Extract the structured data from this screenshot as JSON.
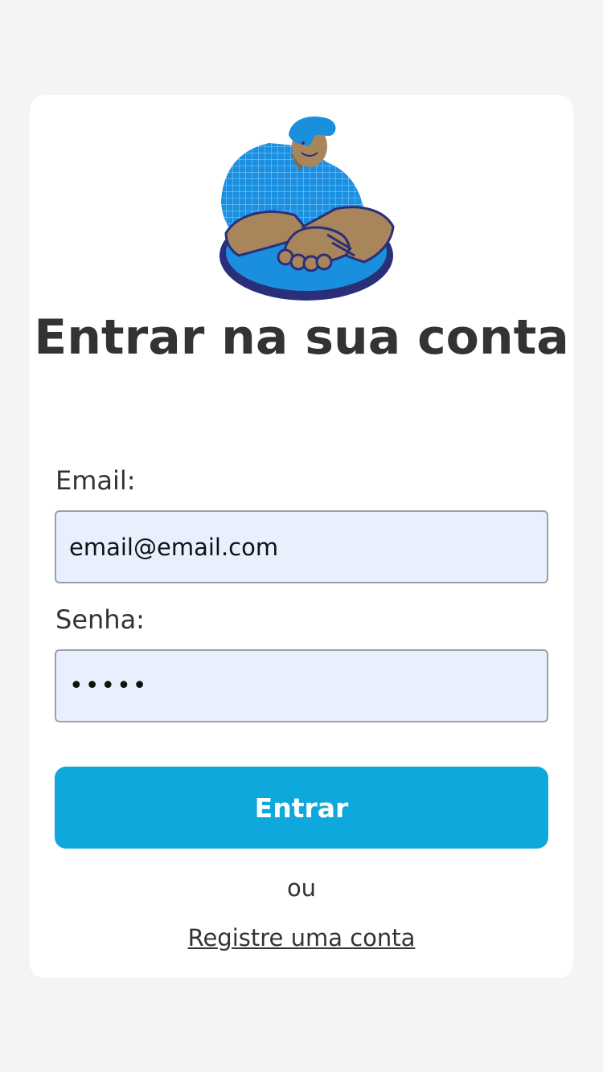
{
  "illustration": {
    "icon": "handshake-illustration",
    "description_colors": {
      "accent": "#0ea8dc",
      "dark": "#2a2f7a",
      "skin": "#a8855a"
    }
  },
  "login": {
    "title": "Entrar na sua conta",
    "email_label": "Email:",
    "email_value": "email@email.com",
    "password_label": "Senha:",
    "password_value": "12345",
    "submit_label": "Entrar",
    "or_text": "ou",
    "register_link": "Registre uma conta"
  },
  "colors": {
    "background": "#f4f4f4",
    "card": "#ffffff",
    "primary_button": "#0ea8dc",
    "input_fill": "#e8f0fe",
    "text": "#333333"
  }
}
